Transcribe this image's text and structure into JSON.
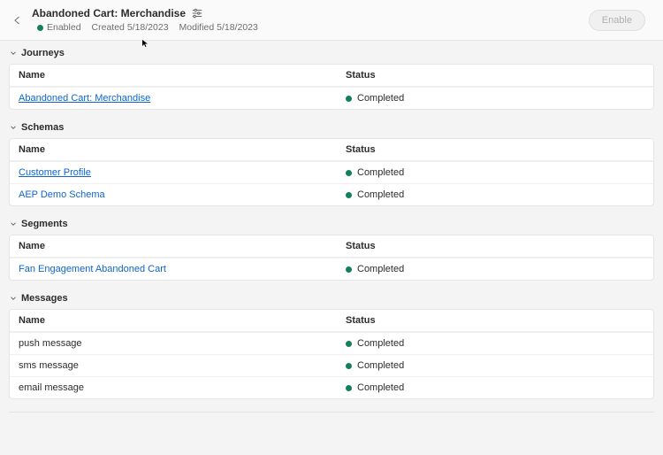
{
  "header": {
    "title": "Abandoned Cart: Merchandise",
    "enabled_label": "Enabled",
    "created_label": "Created 5/18/2023",
    "modified_label": "Modified 5/18/2023",
    "enable_button": "Enable"
  },
  "columns": {
    "name": "Name",
    "status": "Status"
  },
  "status_labels": {
    "completed": "Completed"
  },
  "sections": [
    {
      "title": "Journeys",
      "rows": [
        {
          "name": "Abandoned Cart: Merchandise",
          "status": "Completed",
          "link": true
        }
      ]
    },
    {
      "title": "Schemas",
      "rows": [
        {
          "name": "Customer Profile",
          "status": "Completed",
          "link": true
        },
        {
          "name": "AEP Demo Schema",
          "status": "Completed",
          "linklike": true
        }
      ]
    },
    {
      "title": "Segments",
      "rows": [
        {
          "name": "Fan Engagement Abandoned Cart",
          "status": "Completed",
          "linklike": true
        }
      ]
    },
    {
      "title": "Messages",
      "rows": [
        {
          "name": "push message",
          "status": "Completed"
        },
        {
          "name": "sms message",
          "status": "Completed"
        },
        {
          "name": "email message",
          "status": "Completed"
        }
      ]
    }
  ]
}
